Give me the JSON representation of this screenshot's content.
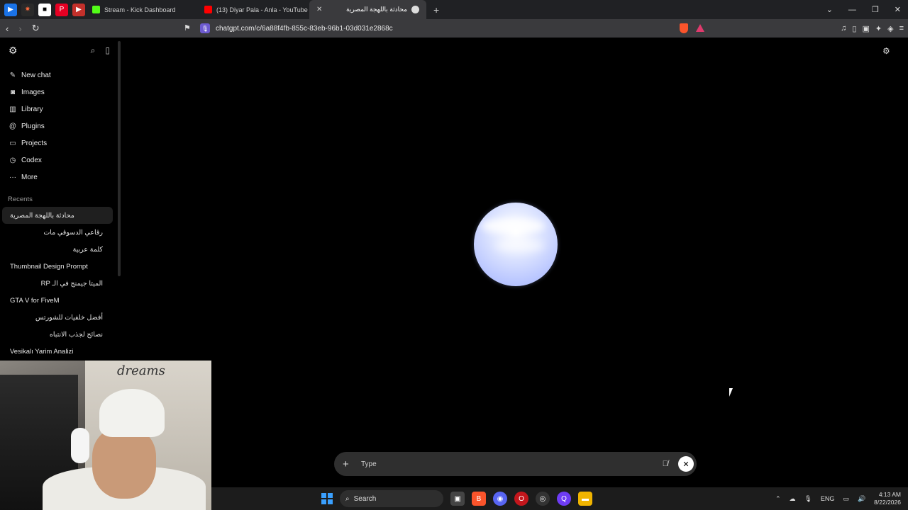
{
  "browser": {
    "tabs": [
      {
        "label": "Stream - Kick Dashboard",
        "color": "#53fc18"
      },
      {
        "label": "(13) Diyar Pala - Anla - YouTube",
        "color": "#ff0000"
      },
      {
        "label": "محادثة باللهجة المصرية",
        "color": "#cccccc"
      }
    ],
    "new_tab": "+",
    "url": "chatgpt.com/c/6a88f4fb-855c-83eb-96b1-03d031e2868c"
  },
  "sidebar": {
    "items": [
      {
        "label": "New chat",
        "icon": "edit-icon"
      },
      {
        "label": "Images",
        "icon": "image-icon"
      },
      {
        "label": "Library",
        "icon": "library-icon"
      },
      {
        "label": "Plugins",
        "icon": "plugins-icon"
      },
      {
        "label": "Projects",
        "icon": "folder-icon"
      },
      {
        "label": "Codex",
        "icon": "codex-icon"
      },
      {
        "label": "More",
        "icon": "more-icon"
      }
    ],
    "recents_heading": "Recents",
    "recents": [
      "محادثة باللهجة المصرية",
      "رقاعي الدسوقي مات",
      "كلمة عربية",
      "Thumbnail Design Prompt",
      "الميتا جيمنج في الـ RP",
      "GTA V for FiveM",
      "أفضل خلفيات للشورتس",
      "نصائح لجذب الانتباه",
      "Vesikalı Yarim Analizi"
    ]
  },
  "composer": {
    "placeholder": "Type"
  },
  "taskbar": {
    "search_label": "Search",
    "language": "ENG",
    "time": "4:13 AM",
    "date": "8/22/2026"
  },
  "webcam": {
    "wall_text": "dreams"
  }
}
